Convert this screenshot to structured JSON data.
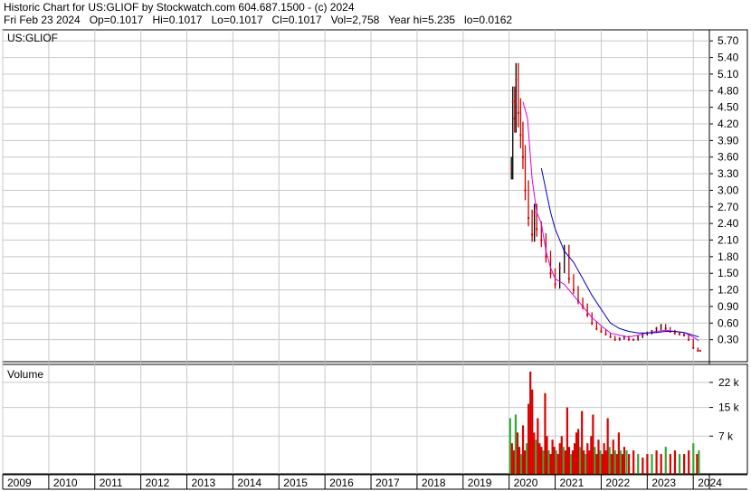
{
  "header": {
    "line1": "Historic Chart for US:GLIOF by Stockwatch.com 604.687.1500 - (c) 2024",
    "line2": "Fri Feb 23 2024   Op=0.1017   Hi=0.1017   Lo=0.1017   Cl=0.1017   Vol=2,758   Year hi=5.235   lo=0.0162"
  },
  "price_panel": {
    "label": "US:GLIOF"
  },
  "volume_panel": {
    "label": "Volume"
  },
  "colors": {
    "grid": "#c8c8c8",
    "bar_up": "#000000",
    "bar_down": "#cc0000",
    "ma_short": "#dd00dd",
    "ma_long": "#0000cc",
    "vol_up": "#33aa33",
    "vol_down": "#dd0000"
  },
  "chart_data": [
    {
      "type": "line",
      "title": "US:GLIOF",
      "x_axis_labels": [
        "2009",
        "2010",
        "2011",
        "2012",
        "2013",
        "2014",
        "2015",
        "2016",
        "2017",
        "2018",
        "2019",
        "2020",
        "2021",
        "2022",
        "2023",
        "2024"
      ],
      "y_tick_labels": [
        "5.70",
        "5.40",
        "5.10",
        "4.80",
        "4.50",
        "4.20",
        "3.90",
        "3.60",
        "3.30",
        "3.00",
        "2.70",
        "2.40",
        "2.10",
        "1.80",
        "1.50",
        "1.20",
        "0.90",
        "0.60",
        "0.30"
      ],
      "ylim": [
        0,
        5.9
      ],
      "grid": true,
      "series": [
        {
          "name": "price",
          "x": [
            2020.05,
            2020.08,
            2020.12,
            2020.15,
            2020.2,
            2020.25,
            2020.3,
            2020.35,
            2020.42,
            2020.5,
            2020.55,
            2020.6,
            2020.7,
            2020.8,
            2020.9,
            2021.0,
            2021.1,
            2021.2,
            2021.3,
            2021.4,
            2021.5,
            2021.6,
            2021.7,
            2021.8,
            2021.9,
            2022.0,
            2022.1,
            2022.2,
            2022.3,
            2022.4,
            2022.5,
            2022.6,
            2022.7,
            2022.8,
            2022.9,
            2023.0,
            2023.1,
            2023.2,
            2023.3,
            2023.4,
            2023.5,
            2023.6,
            2023.7,
            2023.8,
            2023.9,
            2024.0,
            2024.1,
            2024.15
          ],
          "values": [
            3.4,
            4.6,
            4.3,
            5.0,
            4.4,
            4.0,
            3.6,
            3.0,
            2.5,
            2.2,
            2.6,
            2.3,
            2.1,
            1.8,
            1.5,
            1.3,
            1.6,
            1.9,
            1.4,
            1.2,
            1.0,
            0.9,
            0.75,
            0.6,
            0.5,
            0.45,
            0.4,
            0.35,
            0.3,
            0.32,
            0.35,
            0.3,
            0.3,
            0.35,
            0.4,
            0.42,
            0.45,
            0.5,
            0.55,
            0.5,
            0.45,
            0.42,
            0.4,
            0.38,
            0.3,
            0.15,
            0.1,
            0.1
          ]
        },
        {
          "name": "short moving average",
          "x": [
            2020.3,
            2020.4,
            2020.5,
            2020.6,
            2020.7,
            2020.8,
            2020.9,
            2021.0,
            2021.2,
            2021.4,
            2021.6,
            2021.8,
            2022.0,
            2022.2,
            2022.4,
            2022.6,
            2022.8,
            2023.0,
            2023.2,
            2023.4,
            2023.6,
            2023.8,
            2024.0,
            2024.12
          ],
          "values": [
            4.6,
            4.3,
            3.2,
            2.6,
            2.4,
            1.9,
            1.6,
            1.4,
            1.3,
            1.1,
            0.9,
            0.7,
            0.55,
            0.42,
            0.38,
            0.35,
            0.38,
            0.42,
            0.45,
            0.47,
            0.45,
            0.43,
            0.35,
            0.28
          ]
        },
        {
          "name": "long moving average",
          "x": [
            2020.7,
            2020.8,
            2020.9,
            2021.0,
            2021.2,
            2021.4,
            2021.6,
            2021.8,
            2022.0,
            2022.2,
            2022.4,
            2022.6,
            2022.8,
            2023.0,
            2023.2,
            2023.4,
            2023.6,
            2023.8,
            2024.0,
            2024.12
          ],
          "values": [
            3.4,
            3.0,
            2.6,
            2.3,
            1.9,
            1.7,
            1.4,
            1.1,
            0.85,
            0.6,
            0.5,
            0.45,
            0.42,
            0.42,
            0.43,
            0.45,
            0.45,
            0.43,
            0.38,
            0.35
          ]
        }
      ]
    },
    {
      "type": "bar",
      "title": "Volume",
      "y_tick_labels": [
        "22 k",
        "15 k",
        "7 k"
      ],
      "ylim": [
        0,
        25
      ],
      "grid": true,
      "series": [
        {
          "name": "volume",
          "x": [
            2020.02,
            2020.06,
            2020.1,
            2020.14,
            2020.18,
            2020.22,
            2020.26,
            2020.3,
            2020.34,
            2020.38,
            2020.42,
            2020.46,
            2020.5,
            2020.54,
            2020.58,
            2020.62,
            2020.66,
            2020.7,
            2020.74,
            2020.78,
            2020.82,
            2020.86,
            2020.9,
            2020.94,
            2020.98,
            2021.02,
            2021.06,
            2021.1,
            2021.14,
            2021.18,
            2021.22,
            2021.26,
            2021.3,
            2021.34,
            2021.38,
            2021.42,
            2021.46,
            2021.5,
            2021.54,
            2021.58,
            2021.62,
            2021.66,
            2021.7,
            2021.74,
            2021.78,
            2021.82,
            2021.86,
            2021.9,
            2021.94,
            2021.98,
            2022.02,
            2022.06,
            2022.1,
            2022.14,
            2022.18,
            2022.22,
            2022.26,
            2022.3,
            2022.34,
            2022.38,
            2022.42,
            2022.46,
            2022.5,
            2022.55,
            2022.6,
            2022.7,
            2022.8,
            2022.9,
            2023.0,
            2023.1,
            2023.2,
            2023.3,
            2023.4,
            2023.5,
            2023.6,
            2023.7,
            2023.8,
            2023.9,
            2024.0,
            2024.08,
            2024.12
          ],
          "values": [
            12,
            5,
            3,
            13,
            8,
            4,
            2,
            10,
            3,
            5,
            16,
            25,
            20,
            8,
            6,
            12,
            5,
            4,
            3,
            19,
            7,
            3,
            2,
            6,
            4,
            3,
            2,
            5,
            7,
            4,
            3,
            15,
            4,
            2,
            3,
            5,
            8,
            9,
            4,
            14,
            3,
            2,
            5,
            3,
            7,
            13,
            4,
            2,
            6,
            3,
            2,
            5,
            3,
            12,
            4,
            2,
            6,
            3,
            2,
            8,
            3,
            2,
            4,
            3,
            2,
            3,
            2,
            1,
            2,
            2,
            3,
            2,
            4,
            2,
            3,
            2,
            2,
            3,
            5,
            2,
            3
          ],
          "up": [
            1,
            0,
            0,
            1,
            0,
            0,
            1,
            0,
            0,
            1,
            0,
            0,
            0,
            0,
            1,
            0,
            0,
            0,
            1,
            0,
            0,
            1,
            0,
            0,
            0,
            1,
            0,
            0,
            0,
            1,
            0,
            0,
            0,
            1,
            0,
            0,
            0,
            0,
            1,
            0,
            0,
            1,
            0,
            0,
            0,
            0,
            1,
            0,
            0,
            1,
            0,
            0,
            0,
            0,
            1,
            0,
            0,
            1,
            0,
            0,
            1,
            0,
            0,
            1,
            0,
            0,
            1,
            0,
            0,
            1,
            0,
            0,
            1,
            0,
            0,
            1,
            0,
            0,
            1,
            0,
            1
          ]
        }
      ]
    }
  ]
}
